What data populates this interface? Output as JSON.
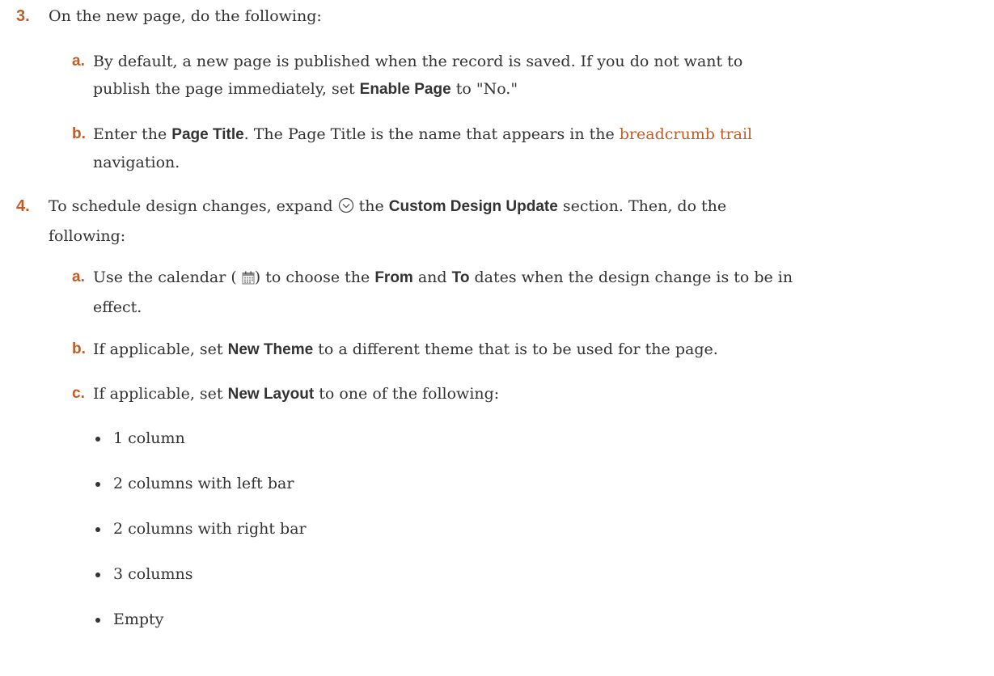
{
  "step3": {
    "number": "3.",
    "intro": "On the new page, do the following:",
    "a": {
      "letter": "a.",
      "t1": "By default, a new page is published when the record is saved. If you do not want to",
      "t2": "publish the page immediately, set ",
      "bold": "Enable Page",
      "t3": " to \"No.\""
    },
    "b": {
      "letter": "b.",
      "t1": "Enter the ",
      "bold": "Page Title",
      "t2": ". The Page Title is the name that appears in the ",
      "link": "breadcrumb trail",
      "t3": "navigation."
    }
  },
  "step4": {
    "number": "4.",
    "t1": "To schedule design changes, expand ",
    "icon_expand": "chevron-down-circle-icon",
    "t2": " the ",
    "bold": "Custom Design Update",
    "t3": " section. Then, do the",
    "t4": "following:",
    "a": {
      "letter": "a.",
      "t1": "Use the calendar ( ",
      "icon_calendar": "calendar-icon",
      "t2": ") to choose the ",
      "bold1": "From",
      "t3": " and ",
      "bold2": "To",
      "t4": " dates when the design change is to be in",
      "t5": "effect."
    },
    "b": {
      "letter": "b.",
      "t1": "If applicable, set ",
      "bold": "New Theme",
      "t2": " to a different theme that is to be used for the page."
    },
    "c": {
      "letter": "c.",
      "t1": "If applicable, set ",
      "bold": "New Layout",
      "t2": " to one of the following:",
      "options": [
        "1 column",
        "2 columns with left bar",
        "2 columns with right bar",
        "3 columns",
        "Empty"
      ]
    }
  },
  "colors": {
    "accent": "#c05c25",
    "text": "#333333"
  }
}
